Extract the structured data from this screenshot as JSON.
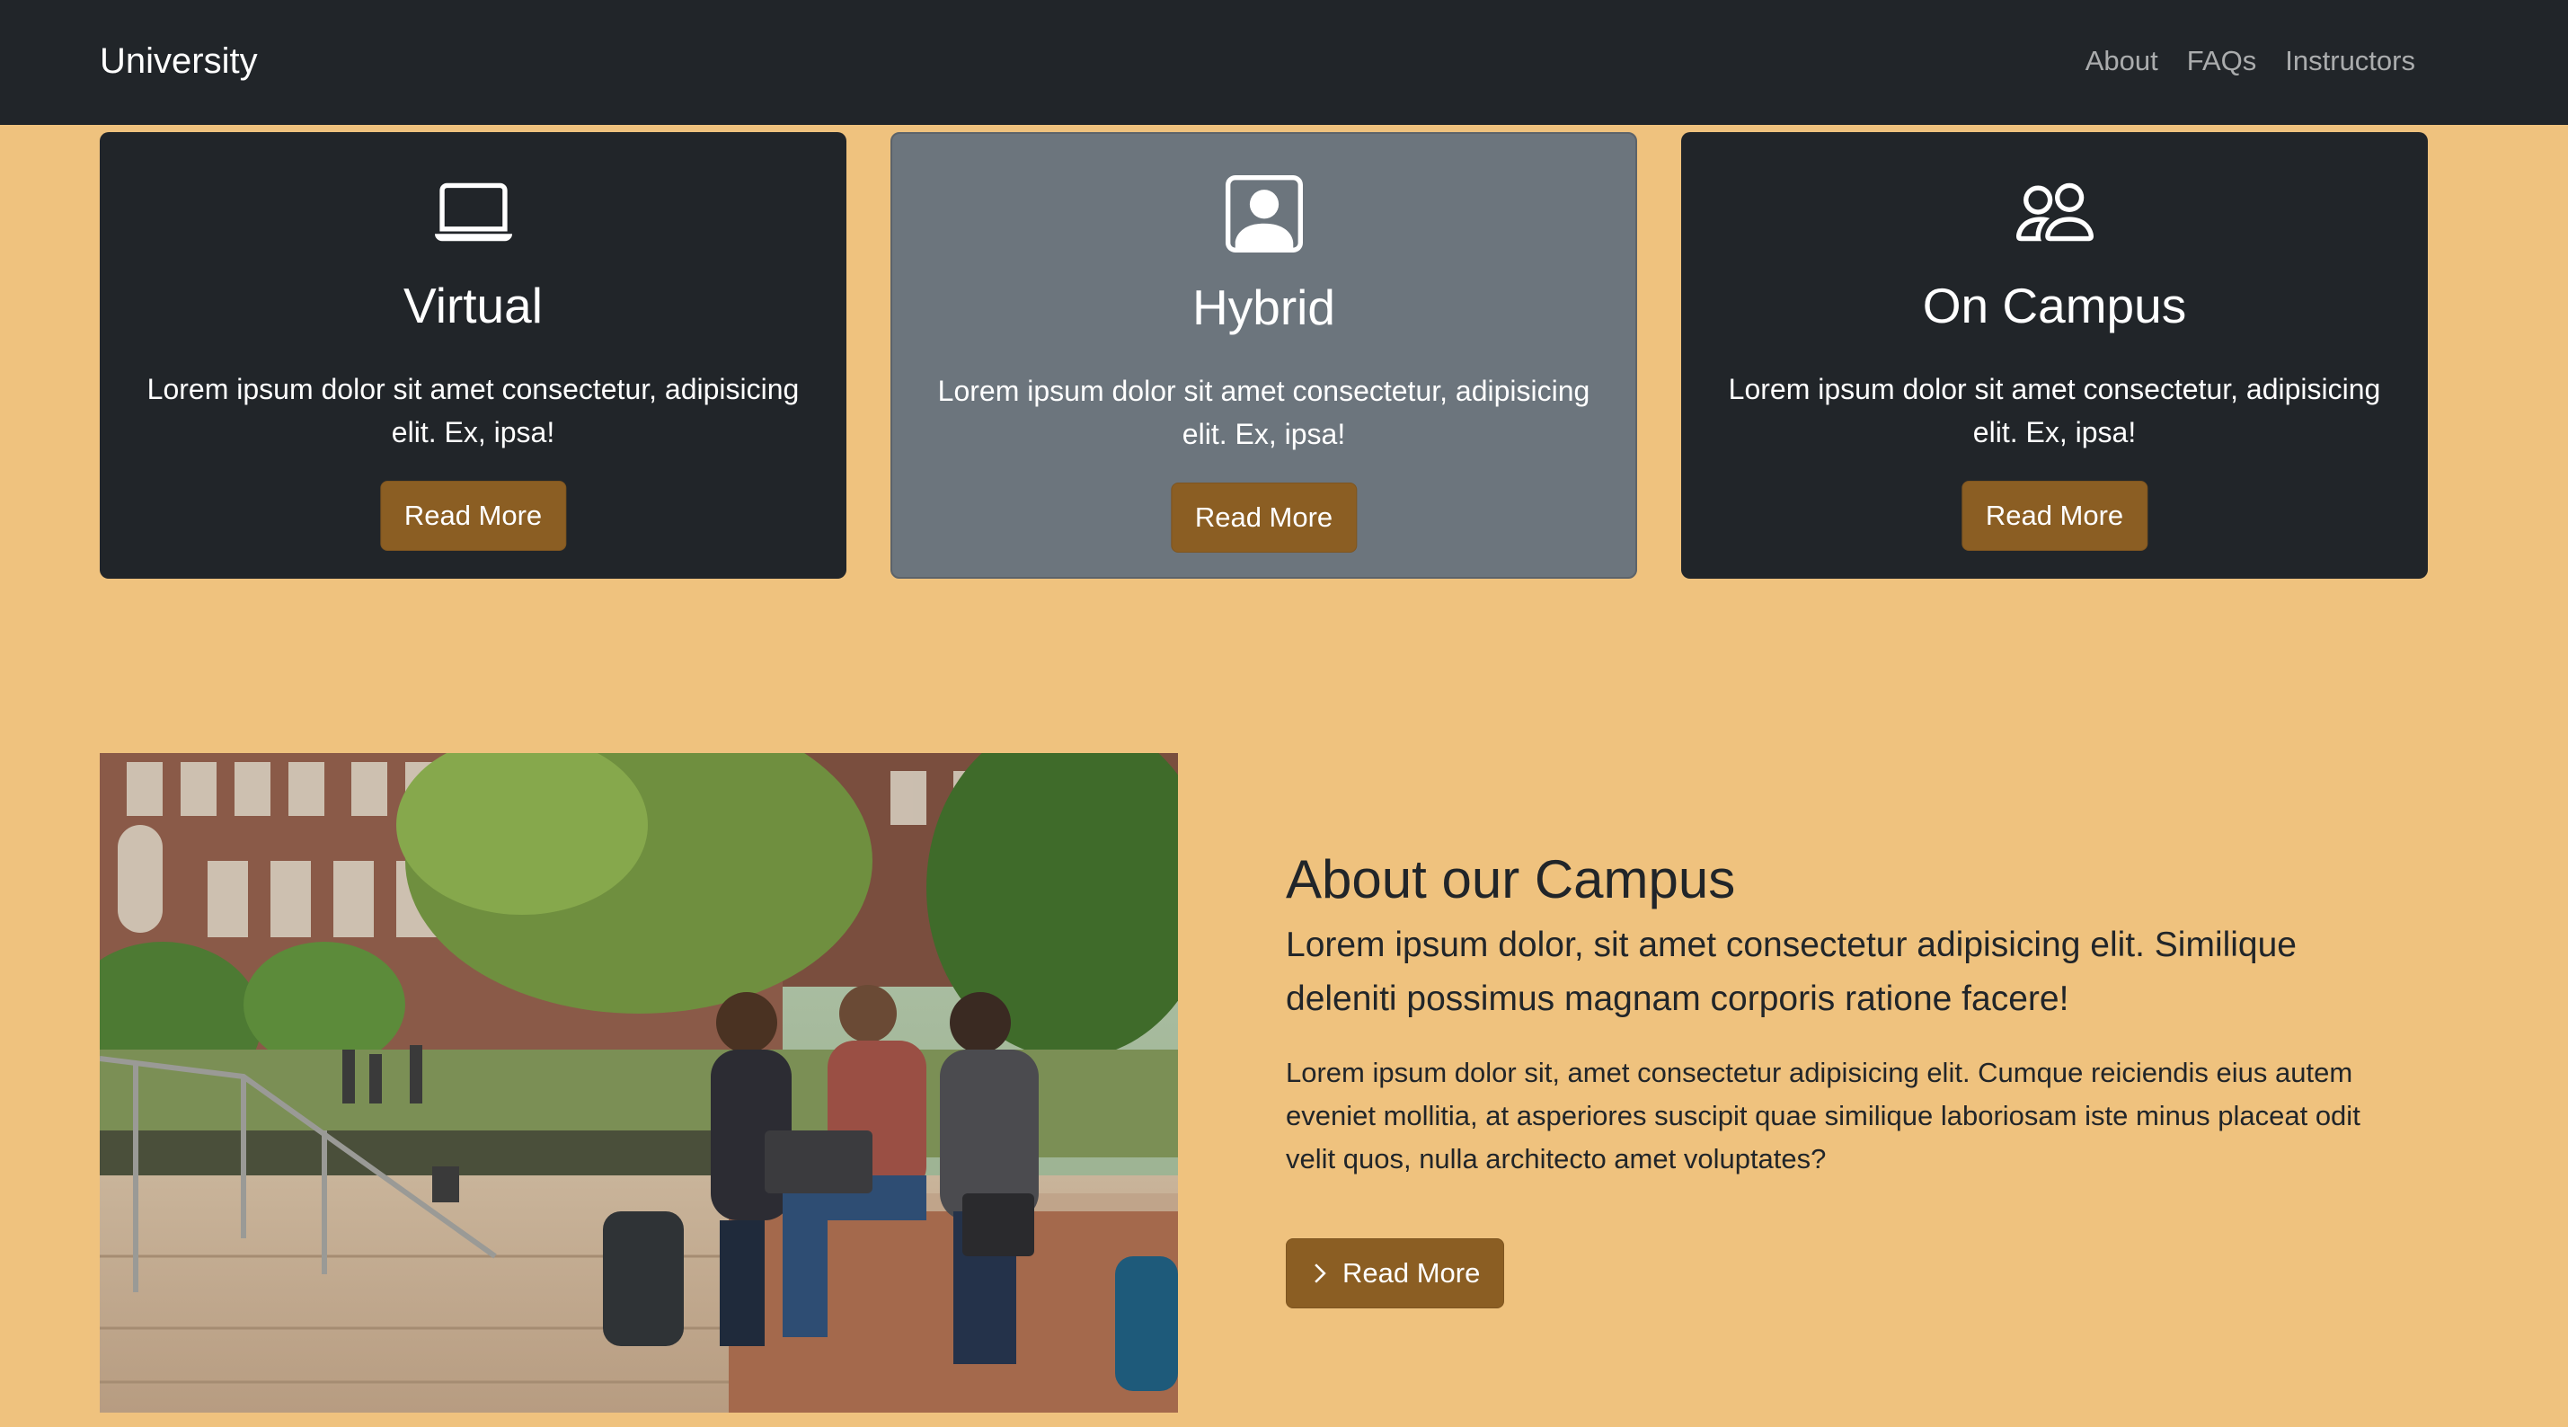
{
  "navbar": {
    "brand": "University",
    "links": [
      "About",
      "FAQs",
      "Instructors"
    ]
  },
  "cards": [
    {
      "title": "Virtual",
      "text": "Lorem ipsum dolor sit amet consectetur, adipisicing elit. Ex, ipsa!",
      "button": "Read More",
      "icon": "laptop-icon"
    },
    {
      "title": "Hybrid",
      "text": "Lorem ipsum dolor sit amet consectetur, adipisicing elit. Ex, ipsa!",
      "button": "Read More",
      "icon": "person-square-icon"
    },
    {
      "title": "On Campus",
      "text": "Lorem ipsum dolor sit amet consectetur, adipisicing elit. Ex, ipsa!",
      "button": "Read More",
      "icon": "people-icon"
    }
  ],
  "about": {
    "title": "About our Campus",
    "lead": "Lorem ipsum dolor, sit amet consectetur adipisicing elit. Similique deleniti possimus magnam corporis ratione facere!",
    "body": "Lorem ipsum dolor sit, amet consectetur adipisicing elit. Cumque reiciendis eius autem eveniet mollitia, at asperiores suscipit quae similique laboriosam iste minus placeat odit velit quos, nulla architecto amet voluptates?",
    "button": "Read More",
    "button_icon": "chevron-right-icon",
    "image": "campus-students-photo"
  },
  "colors": {
    "page_background": "#efc27e",
    "navbar": "#212529",
    "card_dark": "#212529",
    "card_grey": "#6c757d",
    "button": "#8b5e23"
  }
}
